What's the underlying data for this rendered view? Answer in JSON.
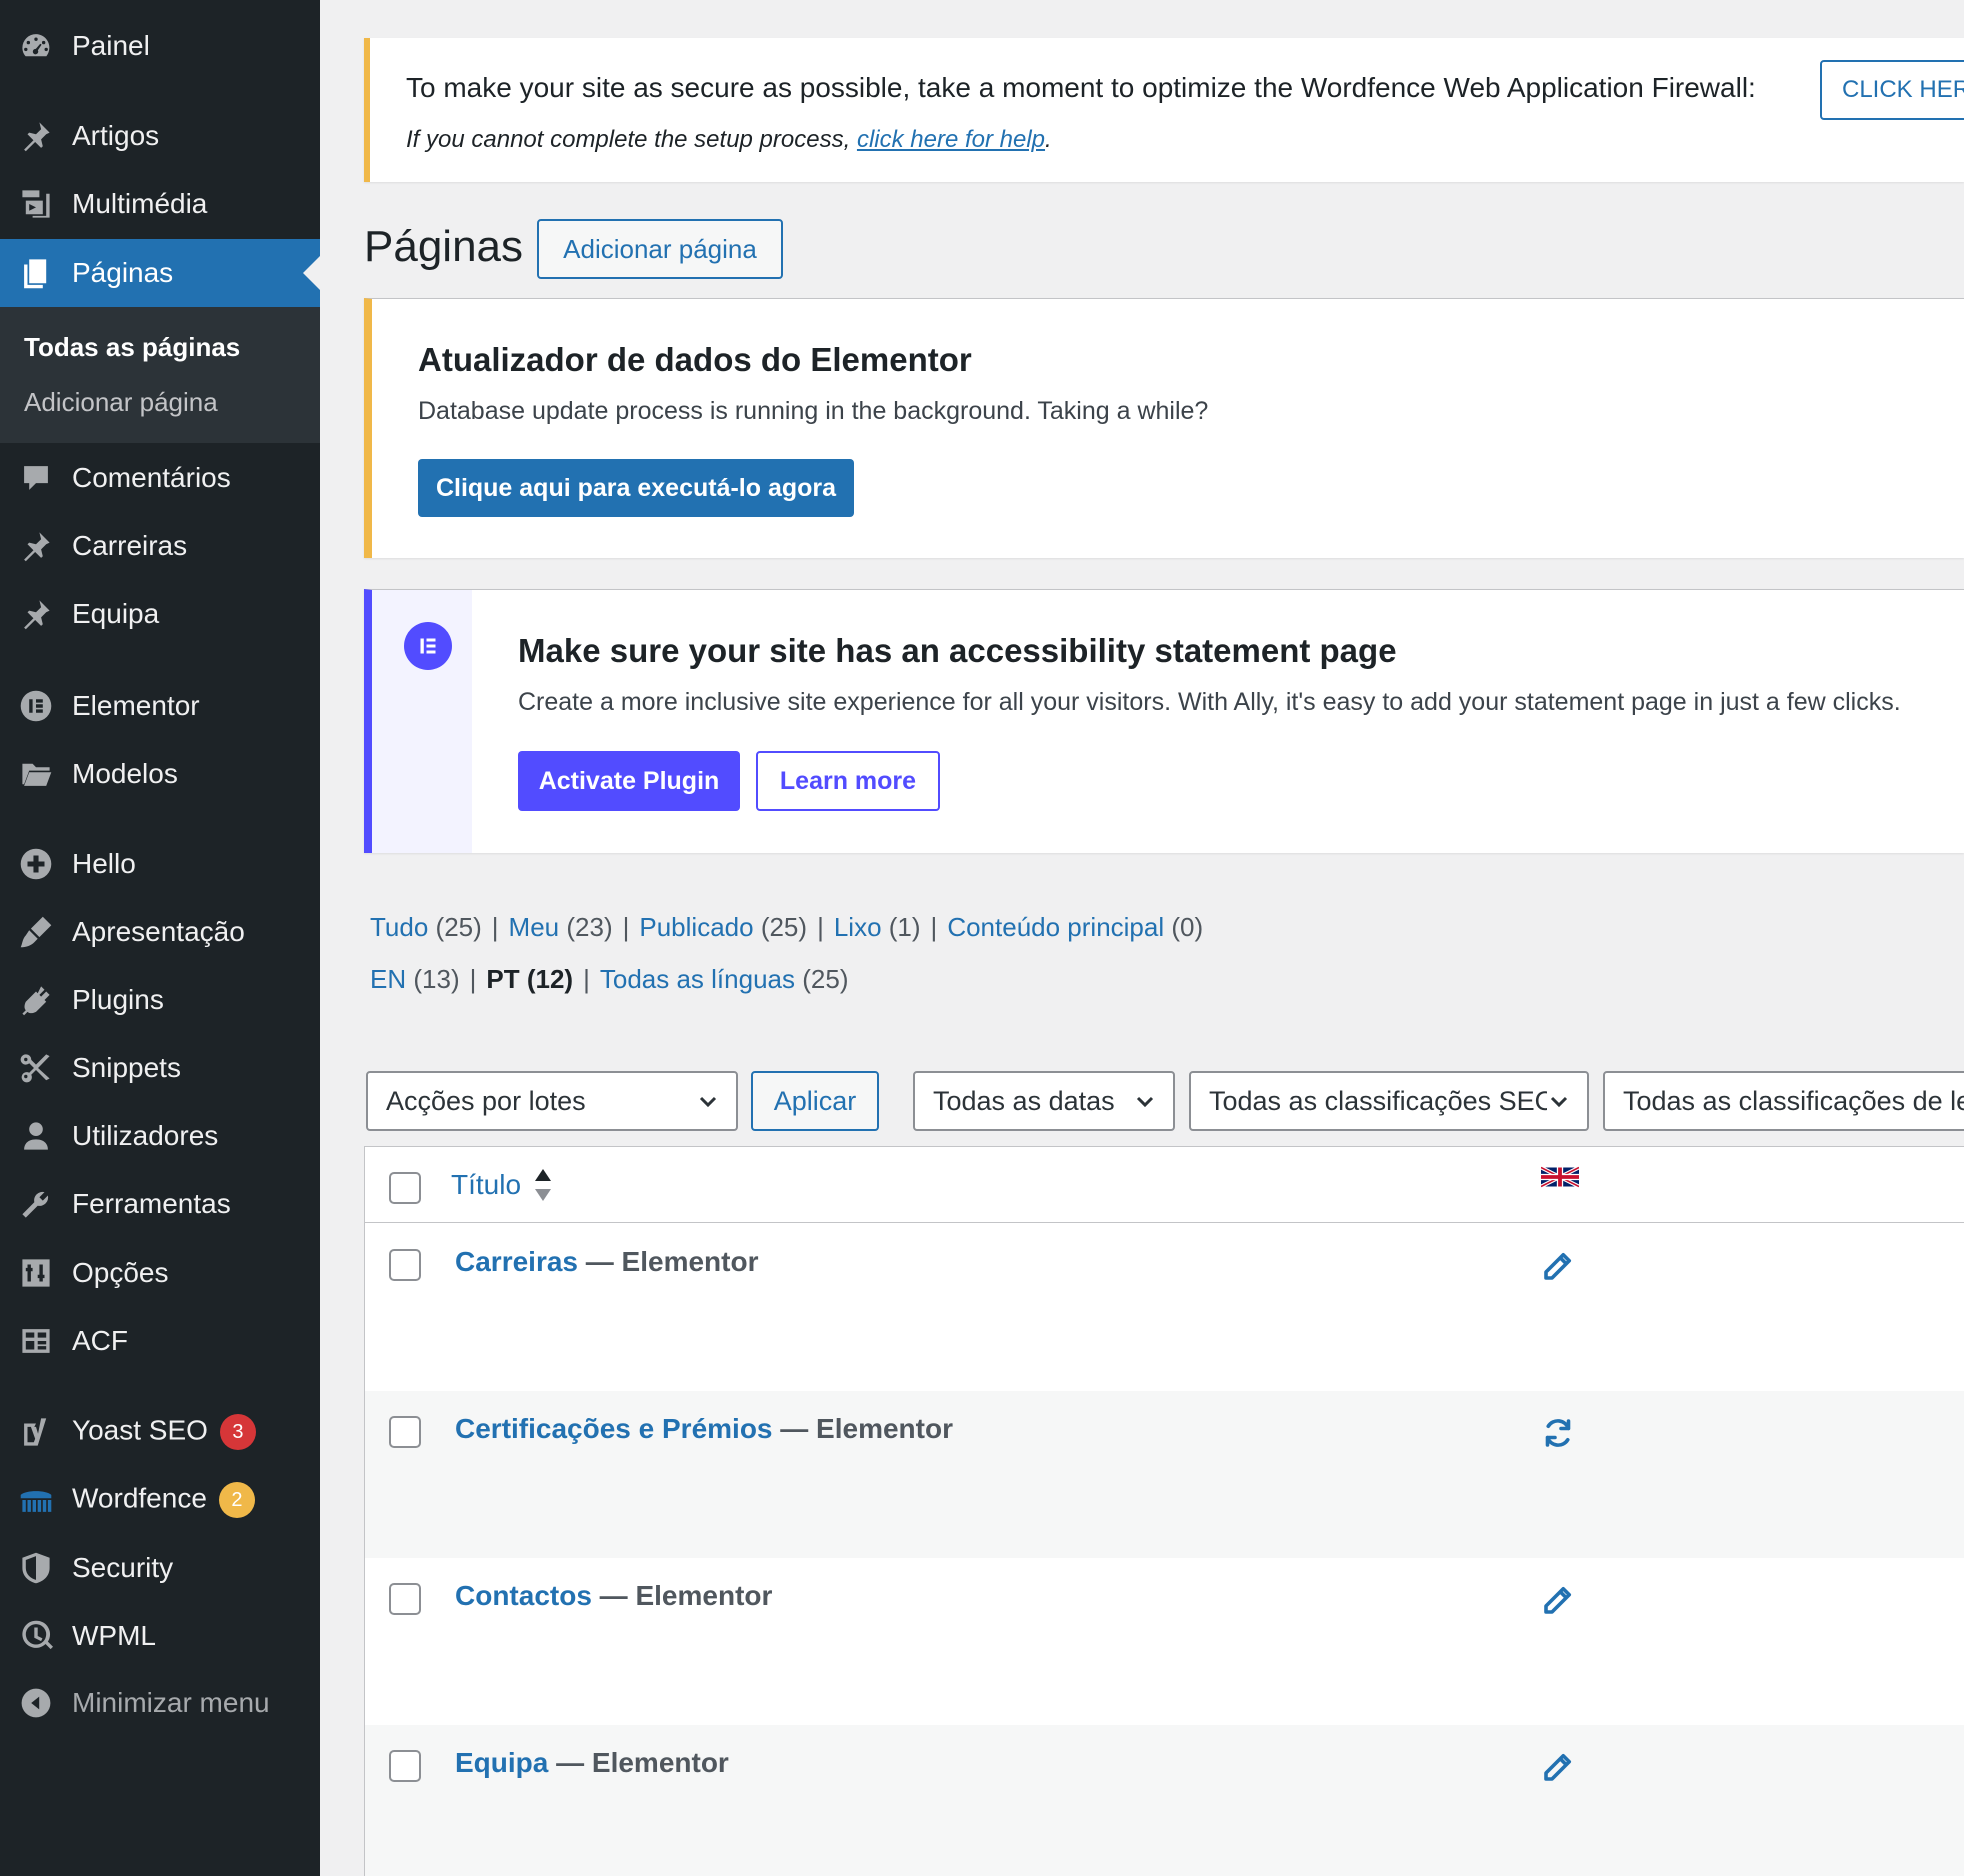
{
  "sidebar": {
    "items": [
      {
        "label": "Painel",
        "icon": "dashboard-icon"
      },
      {
        "label": "Artigos",
        "icon": "pin-icon"
      },
      {
        "label": "Multimédia",
        "icon": "media-icon"
      },
      {
        "label": "Páginas",
        "icon": "pages-icon",
        "current": true
      },
      {
        "label": "Comentários",
        "icon": "comments-icon"
      },
      {
        "label": "Carreiras",
        "icon": "pin-icon"
      },
      {
        "label": "Equipa",
        "icon": "pin-icon"
      },
      {
        "label": "Elementor",
        "icon": "elementor-icon"
      },
      {
        "label": "Modelos",
        "icon": "folder-icon"
      },
      {
        "label": "Hello",
        "icon": "plus-circle-icon"
      },
      {
        "label": "Apresentação",
        "icon": "brush-icon"
      },
      {
        "label": "Plugins",
        "icon": "plug-icon"
      },
      {
        "label": "Snippets",
        "icon": "scissors-icon"
      },
      {
        "label": "Utilizadores",
        "icon": "user-icon"
      },
      {
        "label": "Ferramentas",
        "icon": "wrench-icon"
      },
      {
        "label": "Opções",
        "icon": "settings-sliders-icon"
      },
      {
        "label": "ACF",
        "icon": "acf-grid-icon"
      },
      {
        "label": "Yoast SEO",
        "icon": "yoast-icon",
        "badge": "3"
      },
      {
        "label": "Wordfence",
        "icon": "wordfence-icon",
        "badge": "2"
      },
      {
        "label": "Security",
        "icon": "shield-icon"
      },
      {
        "label": "WPML",
        "icon": "wpml-icon"
      }
    ],
    "submenu": [
      {
        "label": "Todas as páginas",
        "active": true
      },
      {
        "label": "Adicionar página"
      }
    ],
    "collapse_label": "Minimizar menu"
  },
  "wordfence_notice": {
    "message": "To make your site as secure as possible, take a moment to optimize the Wordfence Web Application Firewall:",
    "button": "CLICK HERE",
    "help_prefix": "If you cannot complete the setup process, ",
    "help_link": "click here for help",
    "help_suffix": "."
  },
  "page": {
    "title": "Páginas",
    "add_button": "Adicionar página"
  },
  "elementor_notice": {
    "title": "Atualizador de dados do Elementor",
    "description": "Database update process is running in the background. Taking a while?",
    "button": "Clique aqui para executá-lo agora"
  },
  "ally_notice": {
    "title": "Make sure your site has an accessibility statement page",
    "description": "Create a more inclusive site experience for all your visitors. With Ally, it's easy to add your statement page in just a few clicks.",
    "activate_button": "Activate Plugin",
    "learn_button": "Learn more"
  },
  "filters": {
    "status": [
      {
        "label": "Tudo",
        "count": "(25)"
      },
      {
        "label": "Meu",
        "count": "(23)"
      },
      {
        "label": "Publicado",
        "count": "(25)"
      },
      {
        "label": "Lixo",
        "count": "(1)"
      },
      {
        "label": "Conteúdo principal",
        "count": "(0)"
      }
    ],
    "languages": [
      {
        "label": "EN",
        "count": "(13)"
      },
      {
        "label": "PT",
        "count": "(12)",
        "current": true
      },
      {
        "label": "Todas as línguas",
        "count": "(25)"
      }
    ]
  },
  "bulk": {
    "actions_select": "Acções por lotes",
    "apply_button": "Aplicar",
    "dates_select": "Todas as datas",
    "seo_select": "Todas as classificações SEO",
    "readability_select": "Todas as classificações de legibilidade"
  },
  "table": {
    "column_title": "Título",
    "rows": [
      {
        "title": "Carreiras",
        "state": " — Elementor",
        "lang_action": "pencil-icon"
      },
      {
        "title": "Certificações e Prémios",
        "state": " — Elementor",
        "lang_action": "refresh-icon"
      },
      {
        "title": "Contactos",
        "state": " — Elementor",
        "lang_action": "pencil-icon"
      },
      {
        "title": "Equipa",
        "state": " — Elementor",
        "lang_action": "pencil-icon"
      }
    ]
  },
  "colors": {
    "sidebar_bg": "#1d2327",
    "accent": "#2271b1",
    "warning": "#f0b849",
    "ally_purple": "#524cff",
    "badge_red": "#d63638"
  }
}
